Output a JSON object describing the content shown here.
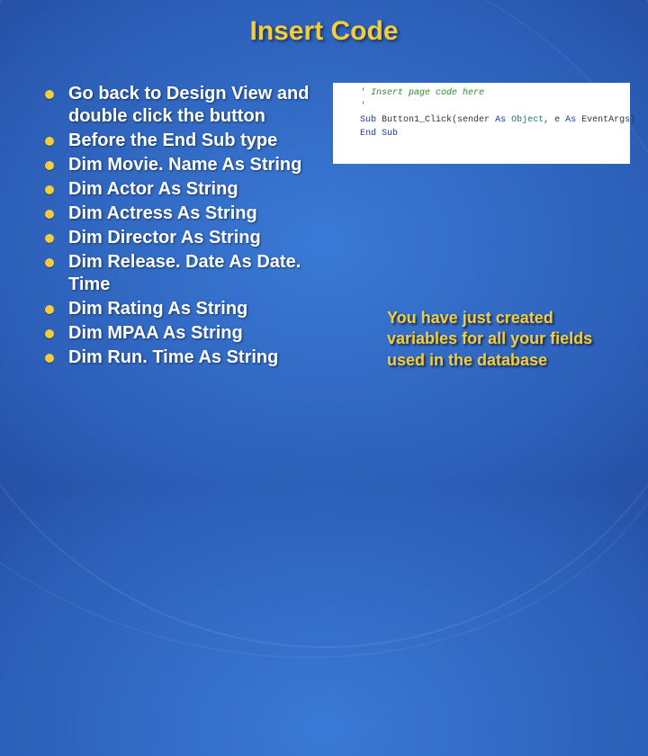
{
  "title": "Insert Code",
  "bullets": [
    "Go back to Design View and double click the button",
    "Before the End Sub type",
    "Dim Movie. Name As String",
    "Dim Actor As String",
    "Dim Actress As String",
    "Dim Director As String",
    "Dim Release. Date As Date. Time",
    "Dim Rating As String",
    "Dim MPAA As String",
    "Dim Run. Time As String"
  ],
  "code": {
    "line1_comment": "' Insert page code here",
    "line2_comment": "'",
    "line3_kw1": "Sub",
    "line3_mid": " Button1_Click(sender ",
    "line3_kw2": "As",
    "line3_mid2": " ",
    "line3_type1": "Object",
    "line3_mid3": ", e ",
    "line3_kw3": "As",
    "line3_mid4": " EventArgs)",
    "line4_blank": "",
    "line5_kw": "End Sub"
  },
  "caption": "You have just created variables for all your fields used in the database"
}
